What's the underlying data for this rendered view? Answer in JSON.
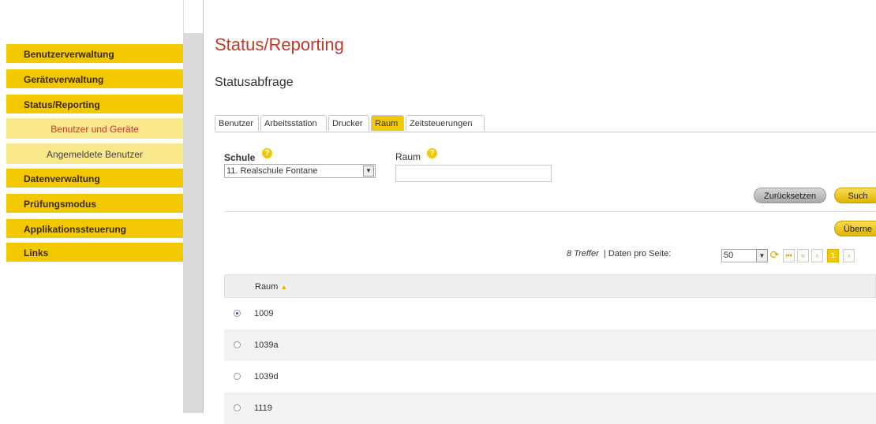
{
  "sidebar": {
    "items": [
      {
        "label": "Benutzerverwaltung"
      },
      {
        "label": "Geräteverwaltung"
      },
      {
        "label": "Status/Reporting"
      },
      {
        "label": "Benutzer und Geräte"
      },
      {
        "label": "Angemeldete Benutzer"
      },
      {
        "label": "Datenverwaltung"
      },
      {
        "label": "Prüfungsmodus"
      },
      {
        "label": "Applikationssteuerung"
      },
      {
        "label": "Links"
      }
    ]
  },
  "header": {
    "title": "Status/Reporting",
    "subtitle": "Statusabfrage"
  },
  "tabs": [
    {
      "label": "Benutzer"
    },
    {
      "label": "Arbeitsstation"
    },
    {
      "label": "Drucker"
    },
    {
      "label": "Raum"
    },
    {
      "label": "Zeitsteuerungen"
    }
  ],
  "form": {
    "schule_label": "Schule",
    "schule_value": "11. Realschule Fontane",
    "raum_label": "Raum",
    "raum_value": "",
    "help_glyph": "?",
    "reset_button": "Zurücksetzen",
    "search_button": "Such",
    "apply_button": "Überne"
  },
  "results": {
    "count_text": "8 Treffer",
    "per_page_label": "Daten pro Seite:",
    "per_page_value": "50",
    "current_page": "1"
  },
  "table": {
    "column": "Raum",
    "rows": [
      {
        "value": "1009",
        "selected": true
      },
      {
        "value": "1039a",
        "selected": false
      },
      {
        "value": "1039d",
        "selected": false
      },
      {
        "value": "1119",
        "selected": false
      }
    ]
  },
  "colors": {
    "accent": "#f2c800",
    "title_red": "#c0392b"
  }
}
